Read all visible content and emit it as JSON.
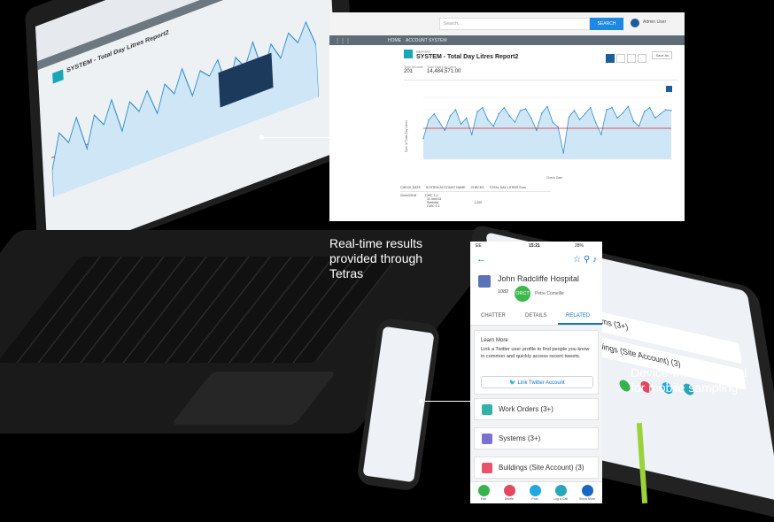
{
  "captions": {
    "realtime_line1": "Real-time results",
    "realtime_line2": "provided through",
    "realtime_line3": "Tetras",
    "portal_line1": "Device-friendly portal",
    "portal_line2": "for mobile sampling"
  },
  "report": {
    "search_placeholder": "Search...",
    "search_button": "SEARCH",
    "user_name": "Admin User",
    "nav": [
      "HOME",
      "ACCOUNT",
      "SYSTEM"
    ],
    "kicker": "REPORT",
    "title": "SYSTEM - Total Day Litres Report2",
    "save_as": "Save As",
    "stats": [
      {
        "label": "Total Records",
        "value": "201"
      },
      {
        "label": "Total Total Day Litres",
        "value": "14,484,571.00"
      }
    ],
    "ylabel": "Sum of Total Day Litres",
    "xlabel": "Check Date",
    "table_headers": [
      "CHECK DATE",
      "SYSTEM ACCOUNT NAME",
      "CHECKS",
      "TOTAL DAY LITRES Sum"
    ],
    "table_cells": [
      "2/mm/2018",
      "CWC 1-1",
      "11.4mV13",
      "Subtotal",
      "1,200",
      "CWC 2-1"
    ]
  },
  "chart_data": {
    "type": "line",
    "ylabel": "Sum of Total Day Litres",
    "xlabel": "Check Date",
    "series": [
      {
        "values": [
          50,
          95,
          110,
          90,
          70,
          105,
          120,
          85,
          100,
          60,
          115,
          125,
          95,
          80,
          110,
          125,
          105,
          90,
          118,
          122,
          100,
          70,
          112,
          128,
          90,
          78,
          15,
          102,
          118,
          96,
          110,
          125,
          88,
          60,
          120,
          125,
          100,
          112,
          128,
          92,
          80,
          115,
          125,
          100,
          110,
          120,
          118
        ]
      }
    ],
    "reference_line": 75,
    "ylim": [
      0,
      150
    ],
    "colors": {
      "line": "#2f8fd0",
      "area": "#cfe6f6",
      "reference": "#d9262e"
    }
  },
  "phone": {
    "carrier": "EE",
    "time": "15:21",
    "battery": "28%",
    "account_name": "John Radcliffe Hospital",
    "account_number": "1082",
    "badge": "ORCT",
    "owner": "Petre Comeille",
    "tabs": [
      "CHATTER",
      "DETAILS",
      "RELATED"
    ],
    "learn_title": "Learn More",
    "learn_text": "Link a Twitter user profile to find people you know in common and quickly access recent tweets.",
    "twitter_button": "Link Twitter Account",
    "related": [
      {
        "label": "Work Orders (3+)",
        "color": "#2fb3a6"
      },
      {
        "label": "Systems (3+)",
        "color": "#7b6fd2"
      },
      {
        "label": "Buildings (Site Account) (3)",
        "color": "#e9546b"
      }
    ],
    "actions": [
      {
        "label": "Edit",
        "color": "#38b24a"
      },
      {
        "label": "Delete",
        "color": "#e4475f"
      },
      {
        "label": "Post",
        "color": "#1fa7e0"
      },
      {
        "label": "Log a Call",
        "color": "#27a8b8"
      },
      {
        "label": "Show More",
        "color": "#1a66c4"
      }
    ]
  },
  "tablet": {
    "rows": [
      "Systems (3+)",
      "Buildings (Site Account) (3)"
    ]
  }
}
